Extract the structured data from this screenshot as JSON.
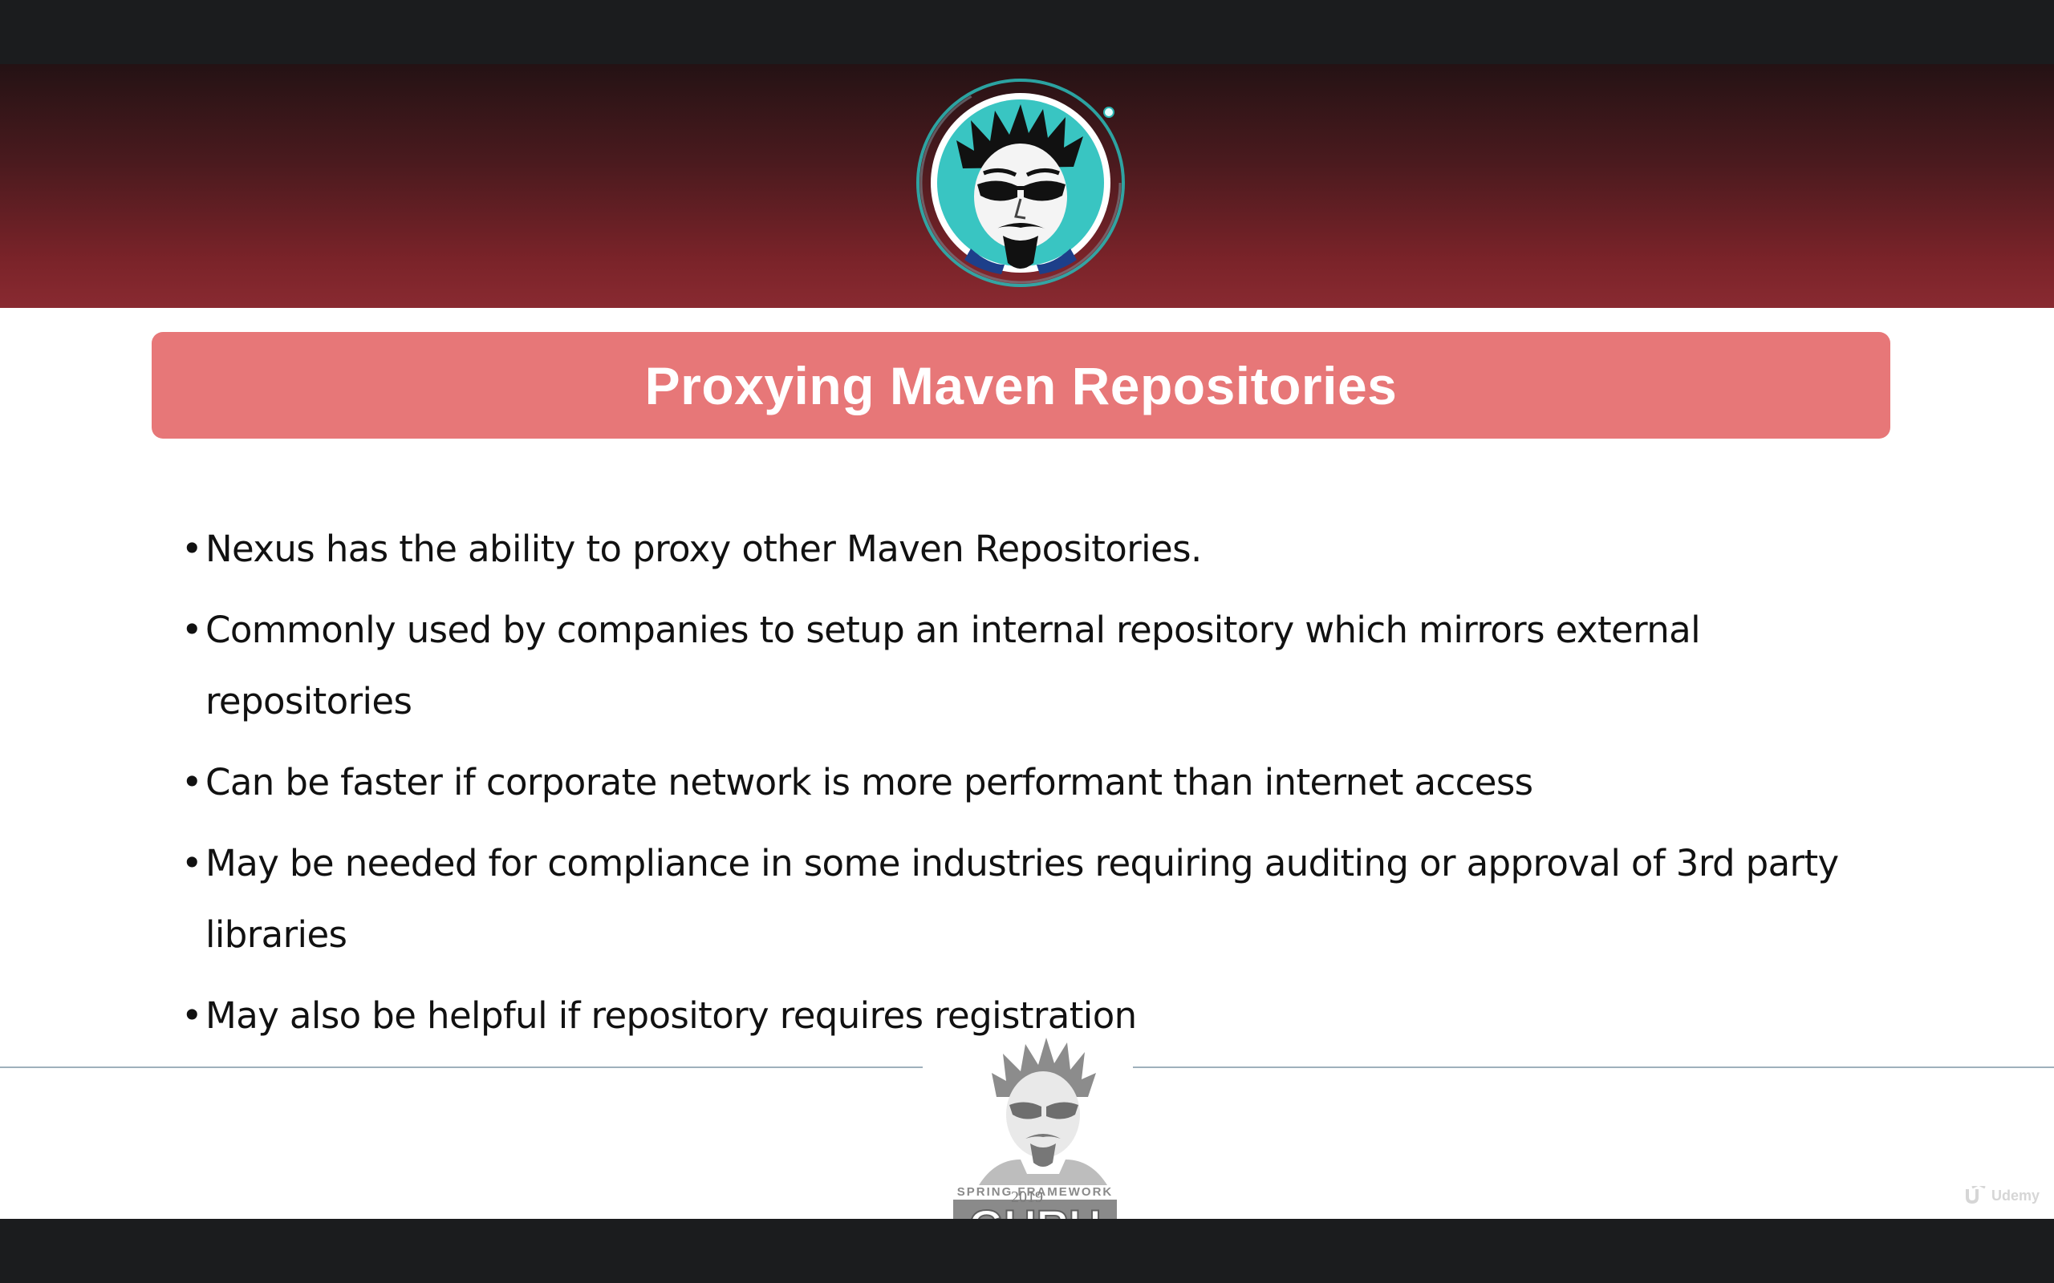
{
  "slide": {
    "title": "Proxying Maven Repositories",
    "bullets": [
      "Nexus has the ability to proxy other Maven Repositories.",
      "Commonly used by companies to setup an internal repository which mirrors external repositories",
      "Can be faster if corporate network is more performant than internet access",
      "May be needed for compliance in some industries requiring auditing or approval of 3rd party libraries",
      "May also be helpful if repository requires registration"
    ],
    "bullet_char": "•"
  },
  "footer_logo": {
    "subtitle": "SPRING FRAMEWORK",
    "name": "GURU",
    "year": "2019"
  },
  "watermark": {
    "text": "Udemy"
  },
  "colors": {
    "title_bg": "#e77778",
    "header_band": "#892a31",
    "letterbox": "#1b1c1e",
    "avatar_ring": "#2bb3b0"
  }
}
